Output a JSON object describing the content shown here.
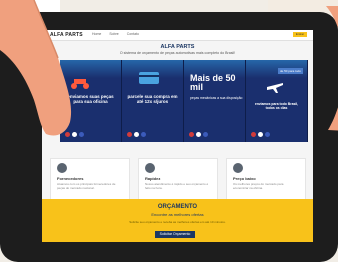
{
  "topnav": {
    "logo": "ALFA PARTS",
    "items": [
      "Home",
      "Sobre",
      "Contato"
    ],
    "cta": "Entrar"
  },
  "hero": {
    "title": "ALFA PARTS",
    "subtitle": "O sistema de orçamento de peças automotivas mais completo do Brasil!"
  },
  "banners": [
    {
      "text": "enviamos suas peças para sua oficina"
    },
    {
      "text": "parcele sua compra em até 12x s/juros"
    },
    {
      "big": "Mais de 50 mil",
      "sub": "peças mecânicas a sua disposição"
    },
    {
      "badge": "de 50 para todo",
      "text": "enviamos para todo Brasil, todos os dias"
    }
  ],
  "features": [
    {
      "title": "Fornecedores",
      "desc": "Atuamos com os principais fornecedores de peças do mercado nacional."
    },
    {
      "title": "Rapidez",
      "desc": "Nosso atendimento é rápido e seu orçamento é feito na hora."
    },
    {
      "title": "Preço baixo",
      "desc": "Os melhores preços do mercado para economizar na oficina."
    }
  ],
  "orcamento": {
    "title": "ORÇAMENTO",
    "subtitle": "Encontre as melhores ofertas",
    "description": "Solicite seu orçamento e receba as melhores ofertas em até 10 minutos.",
    "button": "Solicitar Orçamento"
  },
  "colors": {
    "accent": "#f8c21a",
    "navy": "#1c3763",
    "banner": "#1a2f6e",
    "bezel": "#1d1d1d"
  }
}
